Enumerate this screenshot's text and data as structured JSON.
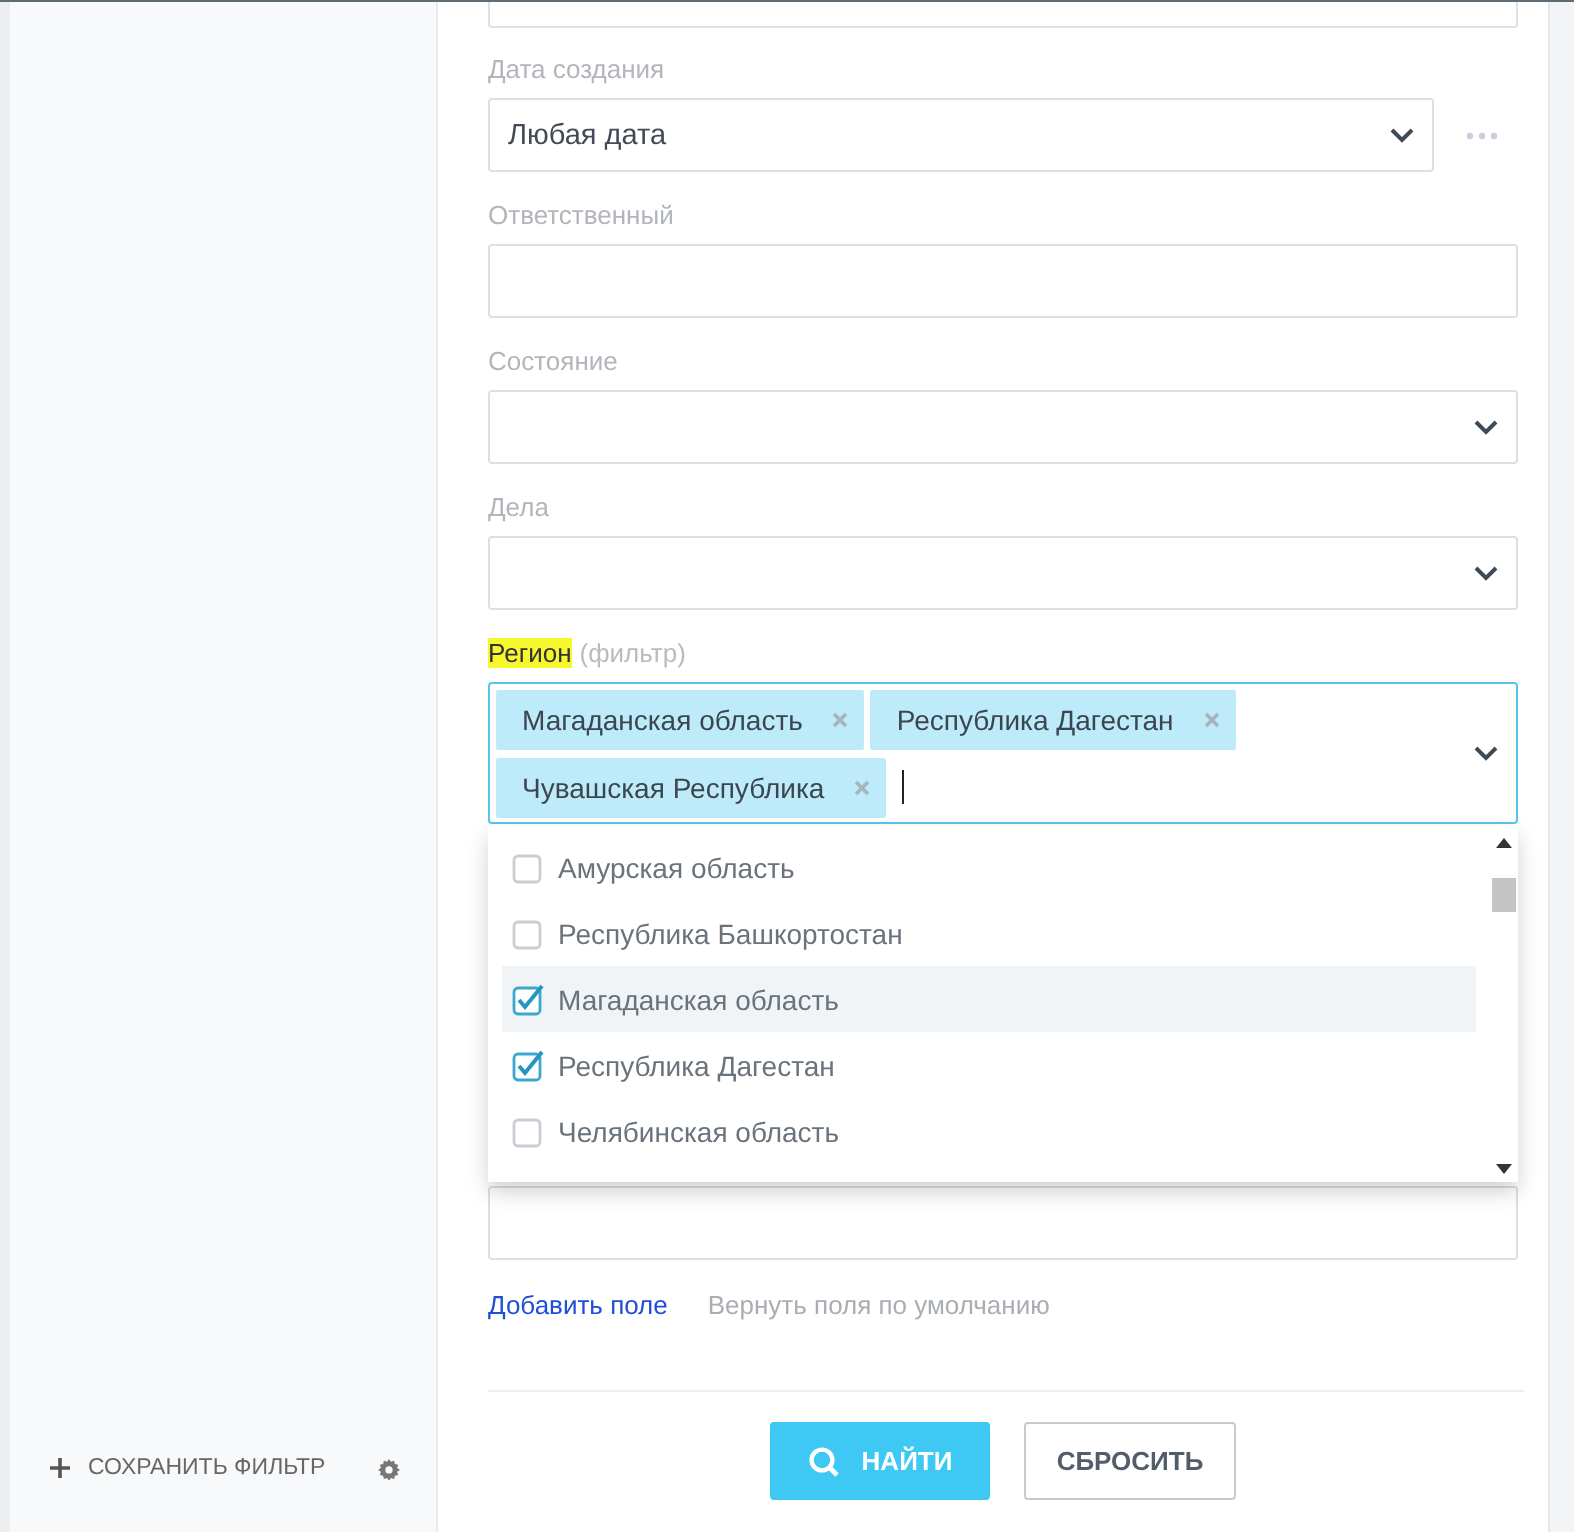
{
  "sidebar": {
    "save_filter": "СОХРАНИТЬ ФИЛЬТР"
  },
  "fields": [
    {
      "label": "Дата создания",
      "kind": "select",
      "value": "Любая дата",
      "more": true
    },
    {
      "label": "Ответственный",
      "kind": "input"
    },
    {
      "label": "Состояние",
      "kind": "select"
    },
    {
      "label": "Дела",
      "kind": "select"
    }
  ],
  "region": {
    "label": "Регион",
    "hint": "(фильтр)",
    "highlighted": true,
    "tags": [
      "Магаданская область",
      "Республика Дагестан",
      "Чувашская Республика"
    ],
    "options": [
      {
        "label": "Амурская область",
        "checked": false,
        "hovered": false
      },
      {
        "label": "Республика Башкортостан",
        "checked": false,
        "hovered": false
      },
      {
        "label": "Магаданская область",
        "checked": true,
        "hovered": true
      },
      {
        "label": "Республика Дагестан",
        "checked": true,
        "hovered": false
      },
      {
        "label": "Челябинская область",
        "checked": false,
        "hovered": false
      }
    ]
  },
  "links": {
    "add_field": "Добавить поле",
    "reset_fields": "Вернуть поля по умолчанию"
  },
  "buttons": {
    "find": "НАЙТИ",
    "reset": "СБРОСИТЬ"
  }
}
